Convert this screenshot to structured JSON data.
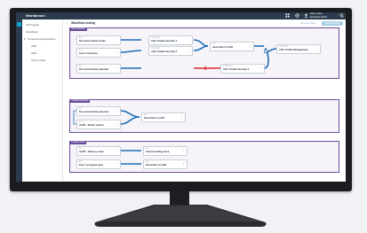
{
  "app": {
    "name": "Workbench"
  },
  "titlebar": {
    "icons": [
      "grid-icon",
      "settings-icon",
      "user-icon"
    ],
    "user_name": "Robin Jones",
    "user_subtitle": "Enterprise Admin"
  },
  "nav": {
    "items": [
      {
        "label": "All Projects"
      },
      {
        "label": "Workflows"
      },
      {
        "label": "Connected Applications"
      },
      {
        "label": "ADD"
      },
      {
        "label": "ADD"
      },
      {
        "label": "work in Nike"
      }
    ]
  },
  "header": {
    "title": "Workflow testing",
    "link_label": "View all Activity",
    "primary_label": "Add Workflow"
  },
  "panels": [
    {
      "tab": "Main Workflow"
    },
    {
      "tab": "Configs Database"
    },
    {
      "tab": "Loading Dock"
    }
  ],
  "cards": [
    {
      "subtitle": "ACT",
      "title": "Personal vehicle inside"
    },
    {
      "subtitle": "ACT",
      "title": "Zone 1 Intrusion"
    },
    {
      "subtitle": "ACT",
      "title": "Personal activity detected"
    },
    {
      "subtitle": "NOTIFYING",
      "title": "Alert Visible Security 1"
    },
    {
      "subtitle": "NOTIFYING",
      "title": "Alert Visible Security 2"
    },
    {
      "subtitle": "ACT",
      "title": "Send Alert to CAD"
    },
    {
      "subtitle": "NOTIFYING",
      "title": "Alert Visible Security 3"
    },
    {
      "subtitle": "NOTIFYING",
      "title": "Alert Visible Management"
    },
    {
      "subtitle": "ACT",
      "title": "Personal activity detected"
    },
    {
      "subtitle": "ACT",
      "title": "ALPR - Stolen vehicle"
    },
    {
      "subtitle": "ACT",
      "title": "Send Alert to CAD"
    },
    {
      "subtitle": "ACT",
      "title": "ALPR - Delivery truck"
    },
    {
      "subtitle": "ACT",
      "title": "Unlock loading dock"
    },
    {
      "subtitle": "ACT",
      "title": "Door 4 propped open"
    },
    {
      "subtitle": "ACT",
      "title": "Send Alert to CAD"
    }
  ],
  "colors": {
    "titlebar": "#2b3b4d",
    "accent_blue": "#12a4d9",
    "connector": "#1f6db5",
    "panel_border": "#6b4c9a",
    "alert_red": "#e0353c"
  }
}
